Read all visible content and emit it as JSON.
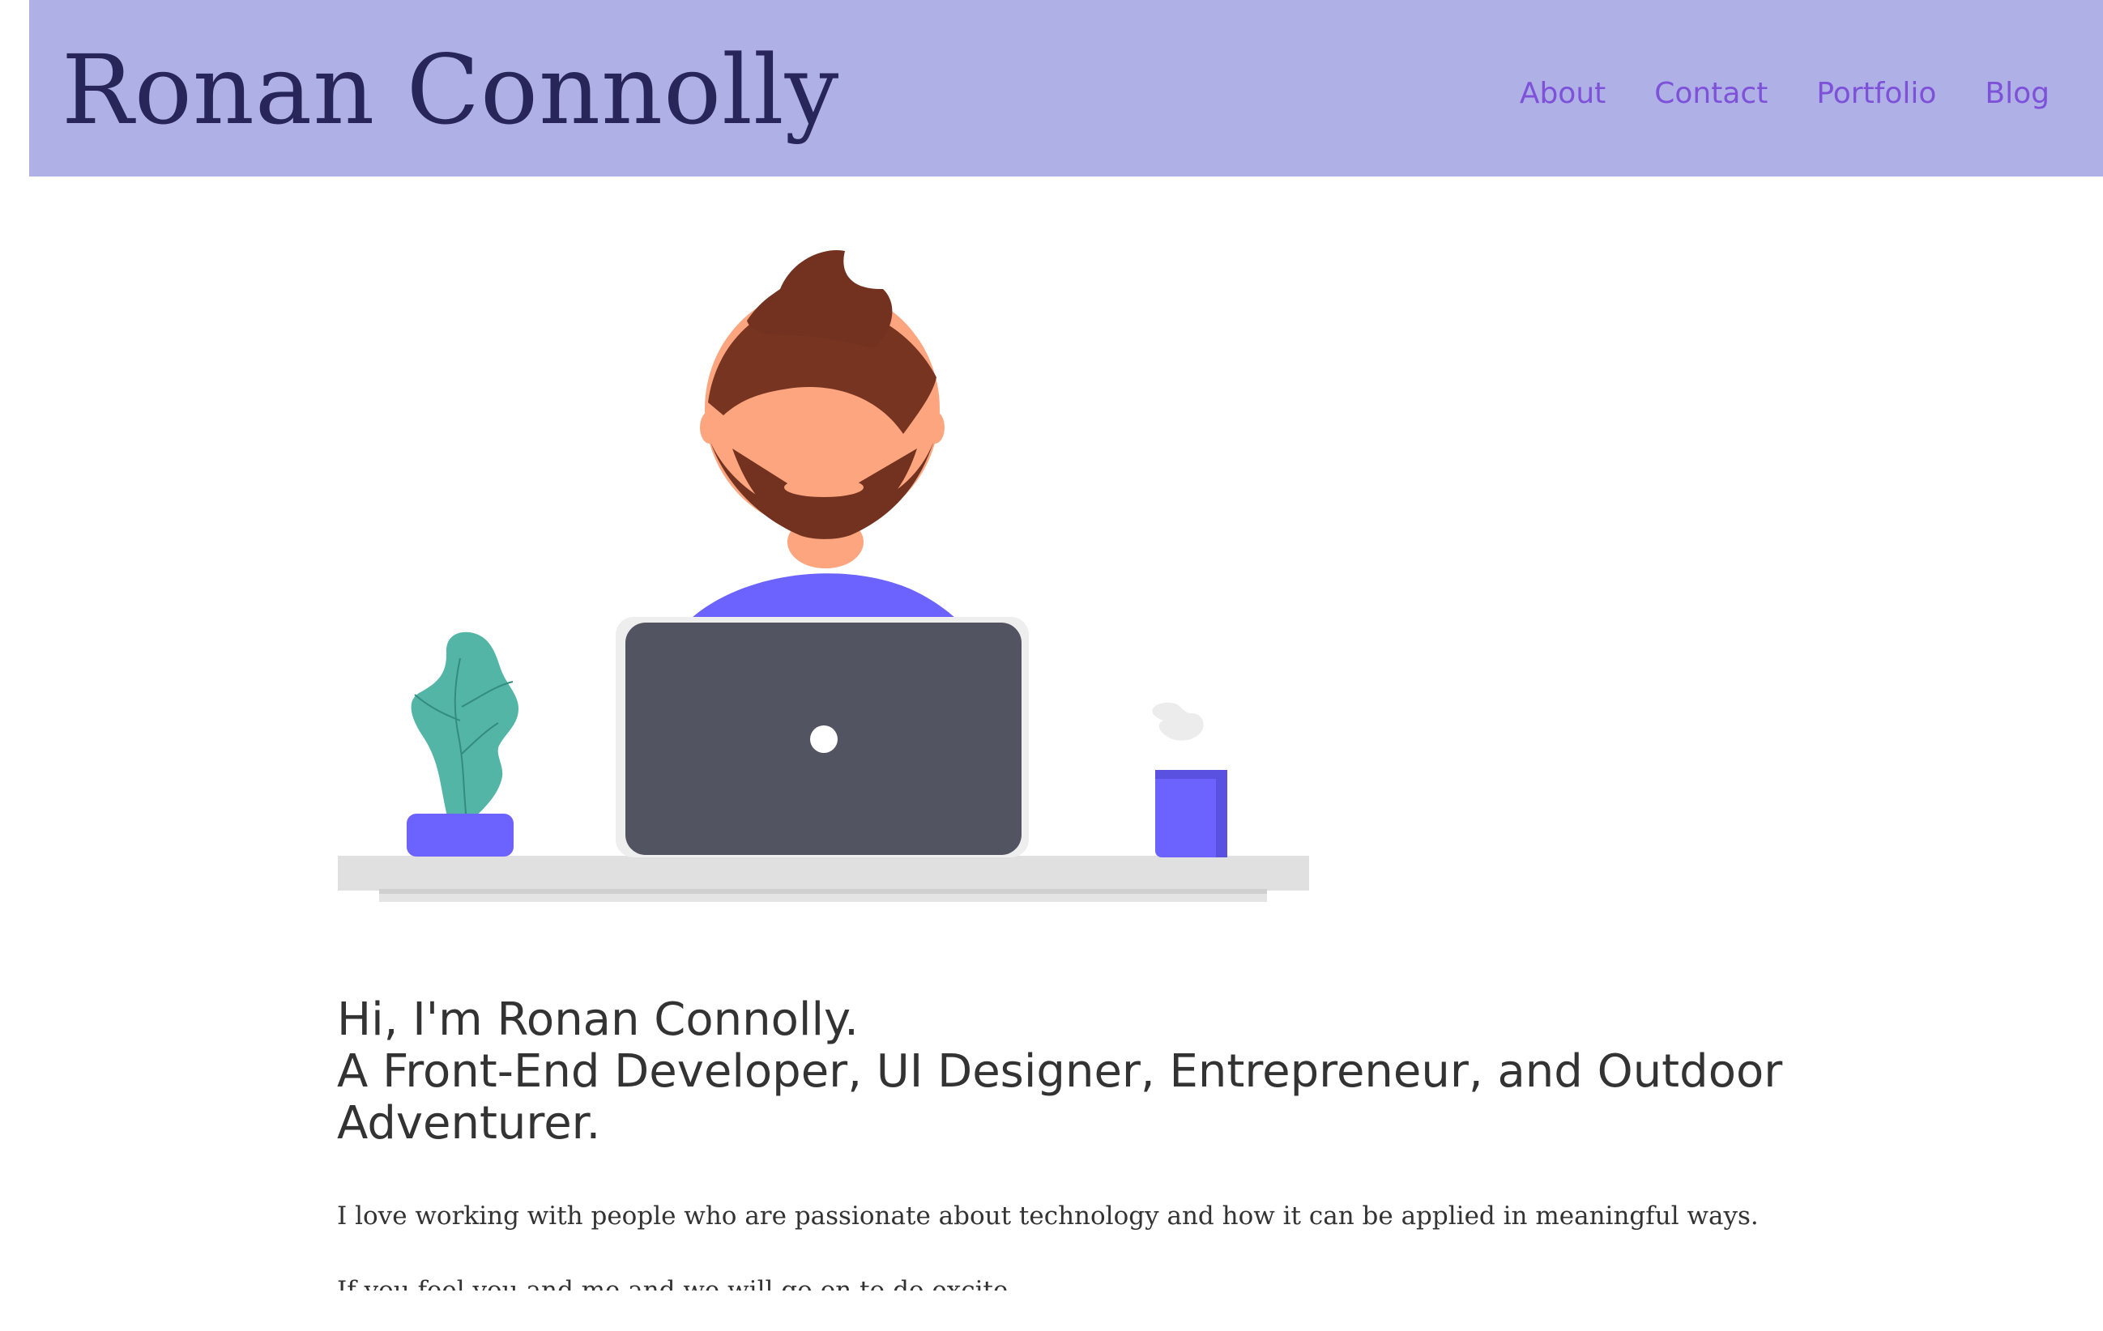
{
  "header": {
    "title": "Ronan Connolly",
    "nav": [
      {
        "label": "About"
      },
      {
        "label": "Contact"
      },
      {
        "label": "Portfolio"
      },
      {
        "label": "Blog"
      }
    ],
    "background_color": "#afb0e6",
    "title_color": "#28255a",
    "nav_color": "#7e51d9"
  },
  "hero": {
    "illustration": "developer-at-laptop-illustration",
    "icons": [
      "plant-icon",
      "laptop-icon",
      "coffee-mug-icon"
    ]
  },
  "content": {
    "heading_line1": "Hi, I'm Ronan Connolly.",
    "heading_line2": "A Front-End Developer, UI Designer, Entrepreneur, and Outdoor Adventurer.",
    "paragraph1": "I love working with people who are passionate about technology and how it can be applied in meaningful ways.",
    "paragraph2": "If you feel you and me and we will go on to do excite..."
  }
}
